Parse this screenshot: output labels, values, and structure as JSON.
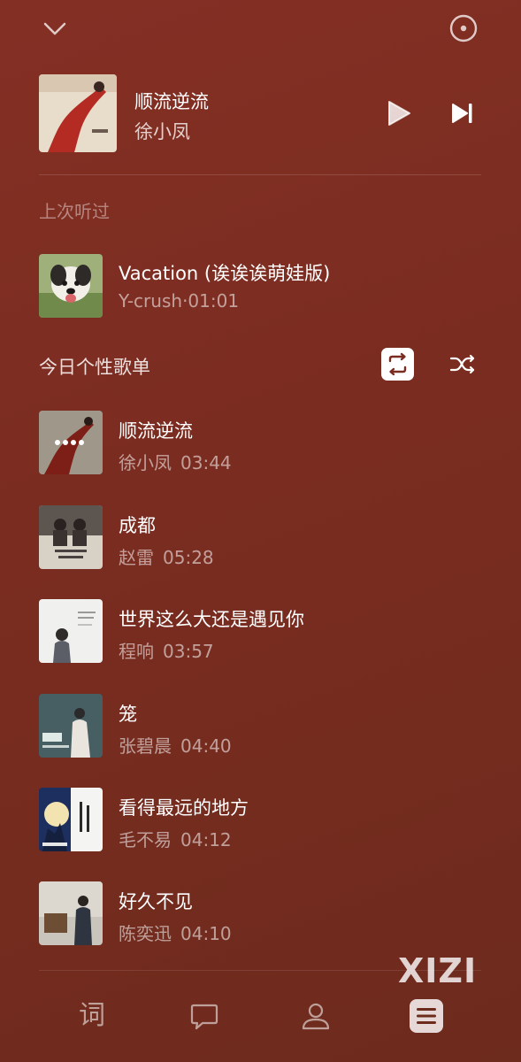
{
  "top_bar": {
    "collapse_icon": "chevron-down-icon",
    "disc_icon": "disc-icon"
  },
  "now_playing": {
    "title": "顺流逆流",
    "artist": "徐小凤",
    "play_icon": "play-icon",
    "next_icon": "next-track-icon"
  },
  "recent": {
    "heading": "上次听过",
    "title": "Vacation (诶诶诶萌娃版)",
    "artist": "Y-crush",
    "separator": "·",
    "duration": "01:01"
  },
  "playlist": {
    "heading": "今日个性歌单",
    "repeat_icon": "repeat-icon",
    "shuffle_icon": "shuffle-icon",
    "songs": [
      {
        "title": "顺流逆流",
        "artist": "徐小凤",
        "duration": "03:44",
        "playing": true
      },
      {
        "title": "成都",
        "artist": "赵雷",
        "duration": "05:28",
        "playing": false
      },
      {
        "title": "世界这么大还是遇见你",
        "artist": "程响",
        "duration": "03:57",
        "playing": false
      },
      {
        "title": "笼",
        "artist": "张碧晨",
        "duration": "04:40",
        "playing": false
      },
      {
        "title": "看得最远的地方",
        "artist": "毛不易",
        "duration": "04:12",
        "playing": false
      },
      {
        "title": "好久不见",
        "artist": "陈奕迅",
        "duration": "04:10",
        "playing": false
      }
    ]
  },
  "watermark": "XIZI",
  "bottom_nav": {
    "lyrics_label": "词",
    "comment_icon": "comment-icon",
    "profile_icon": "profile-icon",
    "playlist_icon": "playlist-icon"
  },
  "colors": {
    "background": "#7a2c20",
    "text_primary": "#ffffff",
    "text_secondary": "rgba(255,255,255,0.55)"
  }
}
